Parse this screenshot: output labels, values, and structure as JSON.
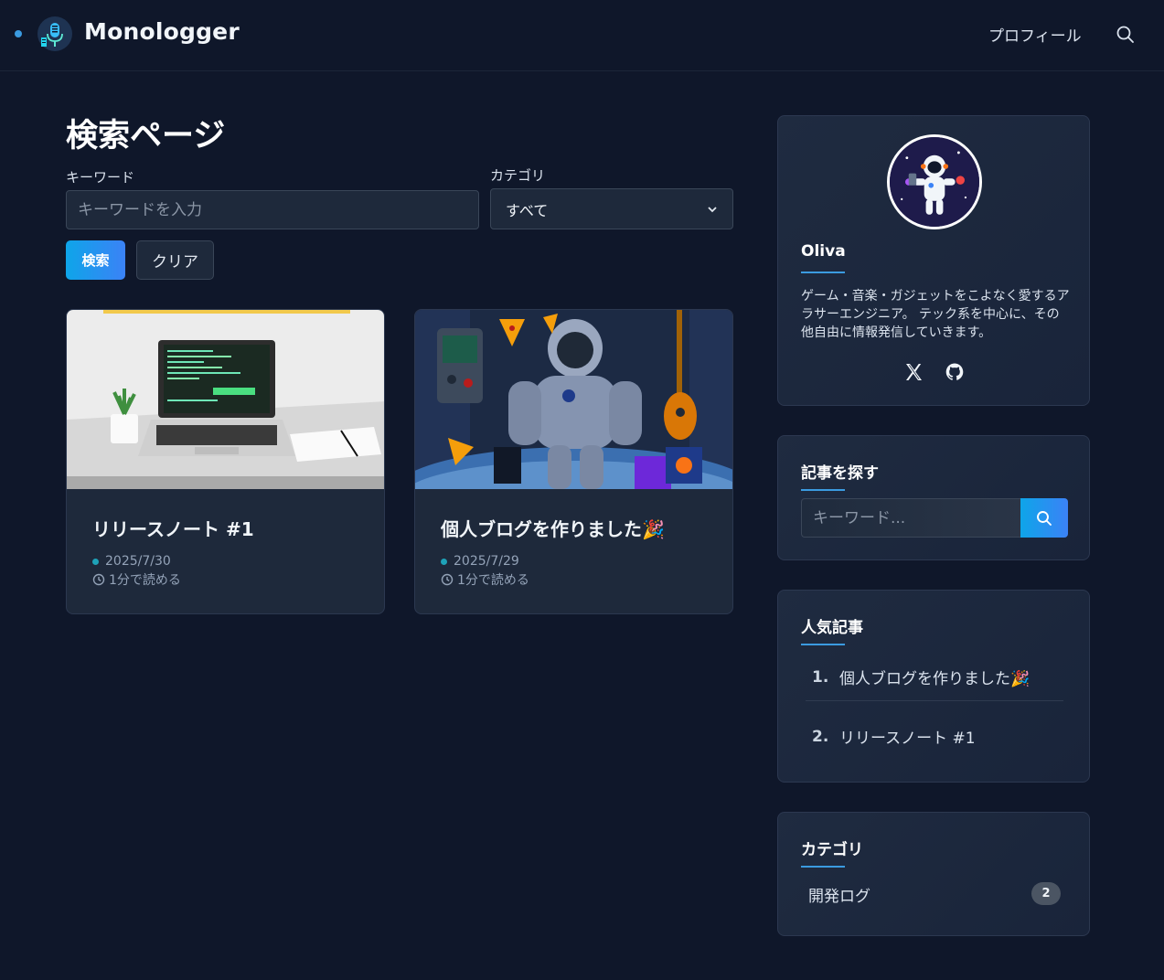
{
  "header": {
    "brand": "Monologger",
    "nav_profile": "プロフィール"
  },
  "search": {
    "title": "検索ページ",
    "keyword_label": "キーワード",
    "keyword_placeholder": "キーワードを入力",
    "category_label": "カテゴリ",
    "category_selected": "すべて",
    "search_button": "検索",
    "clear_button": "クリア"
  },
  "posts": [
    {
      "title": "リリースノート #1",
      "date": "2025/7/30",
      "read_time": "1分で読める"
    },
    {
      "title": "個人ブログを作りました🎉",
      "date": "2025/7/29",
      "read_time": "1分で読める"
    }
  ],
  "sidebar": {
    "profile": {
      "name": "Oliva",
      "bio": "ゲーム・音楽・ガジェットをこよなく愛するアラサーエンジニア。 テック系を中心に、その他自由に情報発信していきます。"
    },
    "find": {
      "title": "記事を探す",
      "placeholder": "キーワード..."
    },
    "popular": {
      "title": "人気記事",
      "items": [
        {
          "num": "1.",
          "title": "個人ブログを作りました🎉"
        },
        {
          "num": "2.",
          "title": "リリースノート #1"
        }
      ]
    },
    "categories": {
      "title": "カテゴリ",
      "items": [
        {
          "name": "開発ログ",
          "count": "2"
        }
      ]
    }
  },
  "colors": {
    "background": "#0f172a",
    "card": "#1e293b",
    "accent": "#3b9be0",
    "button_gradient_start": "#0ea5e9",
    "button_gradient_end": "#3b82f6"
  }
}
